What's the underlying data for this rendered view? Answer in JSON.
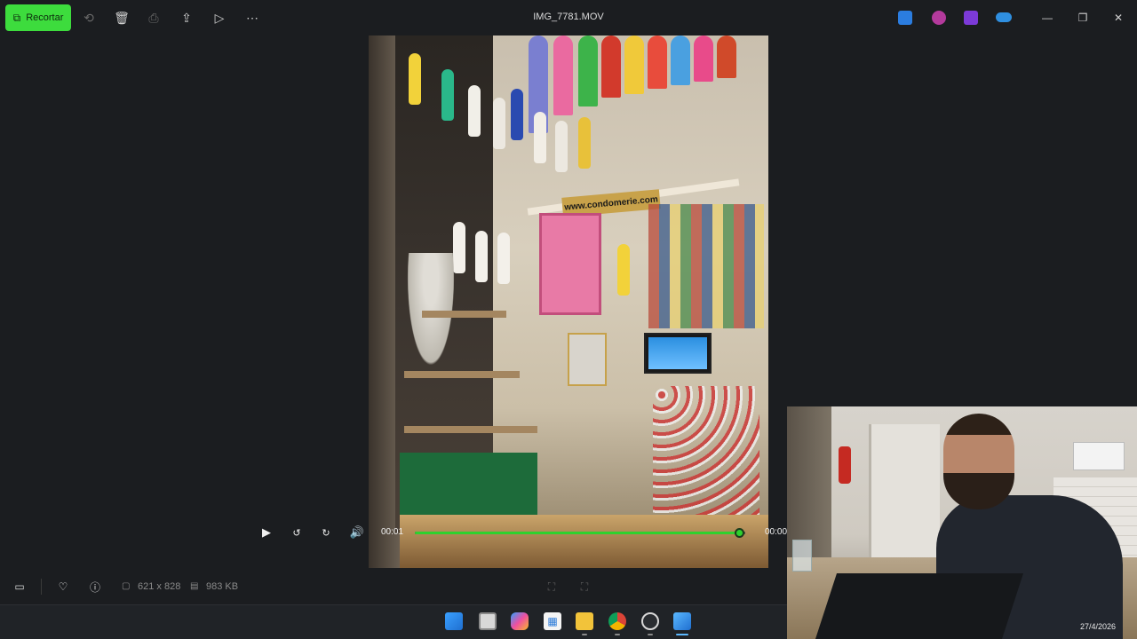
{
  "app": {
    "title": "IMG_7781.MOV",
    "crop_label": "Recortar",
    "accent": "#3ddc3d"
  },
  "toolbar": {
    "icons": [
      "crop-icon",
      "rotate-icon",
      "delete-icon",
      "print-icon",
      "share-icon",
      "slideshow-icon",
      "more-icon"
    ]
  },
  "tray_apps": [
    {
      "name": "photos-app-icon",
      "color": "#2b7de0"
    },
    {
      "name": "copilot-app-icon",
      "color": "#b43a9c"
    },
    {
      "name": "clipchamp-app-icon",
      "color": "#7c3ad8"
    },
    {
      "name": "onedrive-icon",
      "color": "#2f8fe0"
    }
  ],
  "player": {
    "current_time": "00:01",
    "end_time": "00:00",
    "progress": 0.98,
    "progress_color": "#2ed12e"
  },
  "photo": {
    "sign_text": "www.condomerie.com"
  },
  "info": {
    "dimensions": "621 x 828",
    "size": "983 KB"
  },
  "taskbar": {
    "apps": [
      "windows-start-icon",
      "task-view-icon",
      "copilot-icon",
      "microsoft-store-icon",
      "file-explorer-icon",
      "chrome-icon",
      "clock-app-icon",
      "photos-taskbar-icon"
    ]
  },
  "webcam": {
    "date": "27/4/2026"
  }
}
